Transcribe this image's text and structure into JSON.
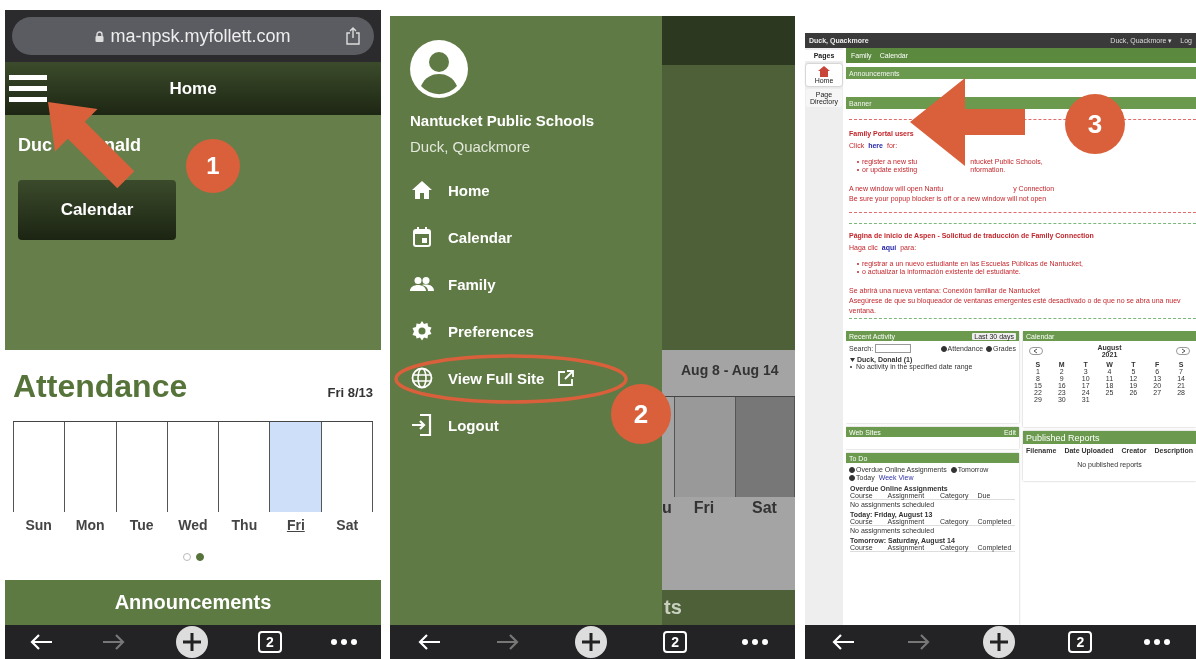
{
  "phone_home": {
    "url": "ma-npsk.myfollett.com",
    "title": "Home",
    "student_name_parts": [
      "Duc",
      "nald"
    ],
    "calendar_button": "Calendar",
    "attendance": {
      "title": "Attendance",
      "date": "Fri 8/13",
      "days": [
        {
          "label": "Sun",
          "selected": false
        },
        {
          "label": "Mon",
          "selected": false
        },
        {
          "label": "Tue",
          "selected": false
        },
        {
          "label": "Wed",
          "selected": false
        },
        {
          "label": "Thu",
          "selected": false
        },
        {
          "label": "Fri",
          "selected": true
        },
        {
          "label": "Sat",
          "selected": false
        }
      ],
      "pages": [
        {
          "selected": false
        },
        {
          "selected": true
        }
      ]
    },
    "announcements": "Announcements",
    "tab_count": "2"
  },
  "phone_menu": {
    "district": "Nantucket Public Schools",
    "user": "Duck, Quackmore",
    "items": [
      {
        "label": "Home",
        "kind": "home",
        "circled": false
      },
      {
        "label": "Calendar",
        "kind": "calendar",
        "circled": false
      },
      {
        "label": "Family",
        "kind": "family",
        "circled": false
      },
      {
        "label": "Preferences",
        "kind": "preferences",
        "circled": false
      },
      {
        "label": "View Full Site",
        "kind": "external",
        "circled": true
      },
      {
        "label": "Logout",
        "kind": "logout",
        "circled": false
      }
    ],
    "background": {
      "week": "Aug 8 - Aug 14",
      "days": [
        "u",
        "Fri",
        "Sat"
      ],
      "footer": "ts"
    },
    "tab_count": "2"
  },
  "desktop_site": {
    "account": "Duck, Quackmore",
    "user_menu": "Duck, Quackmore ▾",
    "logout": "Log",
    "side_tab": "Pages",
    "side_items": [
      {
        "label": "Home",
        "selected": true
      },
      {
        "label": "Page Directory",
        "selected": false
      }
    ],
    "tabs": [
      "Family",
      "Calendar"
    ],
    "announcements": "Announcements",
    "banner": "Banner",
    "english": {
      "heading": "Family Portal users",
      "click": "Click",
      "link": "here",
      "after": "for:",
      "bullets": [
        [
          "register a new stu",
          "ntucket Public Schools,"
        ],
        [
          "or update existing",
          "nformation."
        ]
      ],
      "notes": [
        [
          "A new window will open Nantu",
          "y Connection"
        ],
        [
          "Be sure your popup blocker is off or a new window will not open"
        ]
      ]
    },
    "spanish": {
      "heading": "Página de inicio de Aspen - Solicitud de traducción de Family Connection",
      "click": "Haga clic",
      "link": "aquí",
      "after": "para:",
      "bullets": [
        [
          "registrar a un nuevo estudiante en las Escuelas Públicas de Nantucket,"
        ],
        [
          "o actualizar la información existente del estudiante."
        ]
      ],
      "notes": [
        [
          "Se abrirá una nueva ventana: Conexión familiar de Nantucket"
        ],
        [
          "Asegúrese de que su bloqueador de ventanas emergentes esté desactivado o de que no se abra una nuev"
        ],
        [
          "ventana."
        ]
      ]
    },
    "recent_activity": {
      "title": "Recent Activity",
      "range": "Last 30 days",
      "search_label": "Search:",
      "filters": [
        {
          "label": "Attendance",
          "checked": true
        },
        {
          "label": "Grades",
          "checked": true
        }
      ],
      "student": "Duck, Donald",
      "student_count": "(1)",
      "message": "No activity in the specified date range"
    },
    "calendar": {
      "title": "Calendar",
      "month": "August",
      "year": "2021",
      "weekdays": [
        "S",
        "M",
        "T",
        "W",
        "T",
        "F",
        "S"
      ],
      "weeks": [
        [
          "1",
          "2",
          "3",
          "4",
          "5",
          "6",
          "7"
        ],
        [
          "8",
          "9",
          "10",
          "11",
          "12",
          "13",
          "14"
        ],
        [
          "15",
          "16",
          "17",
          "18",
          "19",
          "20",
          "21"
        ],
        [
          "22",
          "23",
          "24",
          "25",
          "26",
          "27",
          "28"
        ],
        [
          "29",
          "30",
          "31"
        ]
      ]
    },
    "published_reports": {
      "title": "Published Reports",
      "columns": [
        "Filename",
        "Date Uploaded",
        "Creator",
        "Description"
      ],
      "empty": "No published reports"
    },
    "web_sites": {
      "title": "Web Sites",
      "action": "Edit"
    },
    "todo": {
      "title": "To Do",
      "options": [
        {
          "label": "Overdue Online Assignments",
          "checked": true
        },
        {
          "label": "Tomorrow",
          "checked": true
        },
        {
          "label": "Today",
          "checked": true
        }
      ],
      "view_link": "Week View",
      "sections": [
        {
          "heading": "Overdue Online Assignments",
          "columns": [
            "Course",
            "Assignment",
            "Category",
            "Due"
          ],
          "empty": "No assignments scheduled"
        },
        {
          "heading": "Today: Friday, August 13",
          "columns": [
            "Course",
            "Assignment",
            "Category",
            "Completed"
          ],
          "empty": "No assignments scheduled"
        },
        {
          "heading": "Tomorrow: Saturday, August 14",
          "columns": [
            "Course",
            "Assignment",
            "Category",
            "Completed"
          ]
        }
      ]
    },
    "tab_count": "2"
  },
  "callouts": [
    {
      "number": "1"
    },
    {
      "number": "2"
    },
    {
      "number": "3"
    }
  ]
}
